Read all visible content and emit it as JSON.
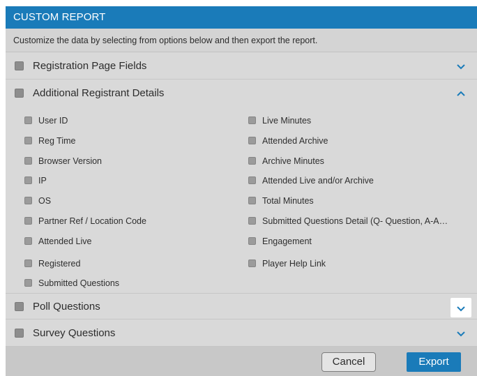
{
  "dialog": {
    "title": "CUSTOM REPORT",
    "subtitle": "Customize the data by selecting from options below and then export the report."
  },
  "sections": {
    "registration": {
      "label": "Registration Page Fields",
      "expanded": false
    },
    "additional": {
      "label": "Additional Registrant Details",
      "expanded": true
    },
    "poll": {
      "label": "Poll Questions",
      "expanded": false
    },
    "survey": {
      "label": "Survey Questions",
      "expanded": false
    }
  },
  "additional_items": {
    "left": [
      "User ID",
      "Reg Time",
      "Browser Version",
      "IP",
      "OS",
      "Partner Ref / Location Code",
      "Attended Live",
      "Registered",
      "Submitted Questions"
    ],
    "right": [
      "Live Minutes",
      "Attended Archive",
      "Archive Minutes",
      "Attended Live and/or Archive",
      "Total Minutes",
      "Submitted Questions Detail (Q- Question, A-A…",
      "Engagement",
      "Player Help Link"
    ]
  },
  "footer": {
    "cancel_label": "Cancel",
    "export_label": "Export"
  },
  "colors": {
    "accent": "#1a7bb9",
    "chevron": "#1a7bb9"
  },
  "icons": {
    "collapsed": "chevron-down-icon",
    "expanded": "chevron-up-icon"
  }
}
